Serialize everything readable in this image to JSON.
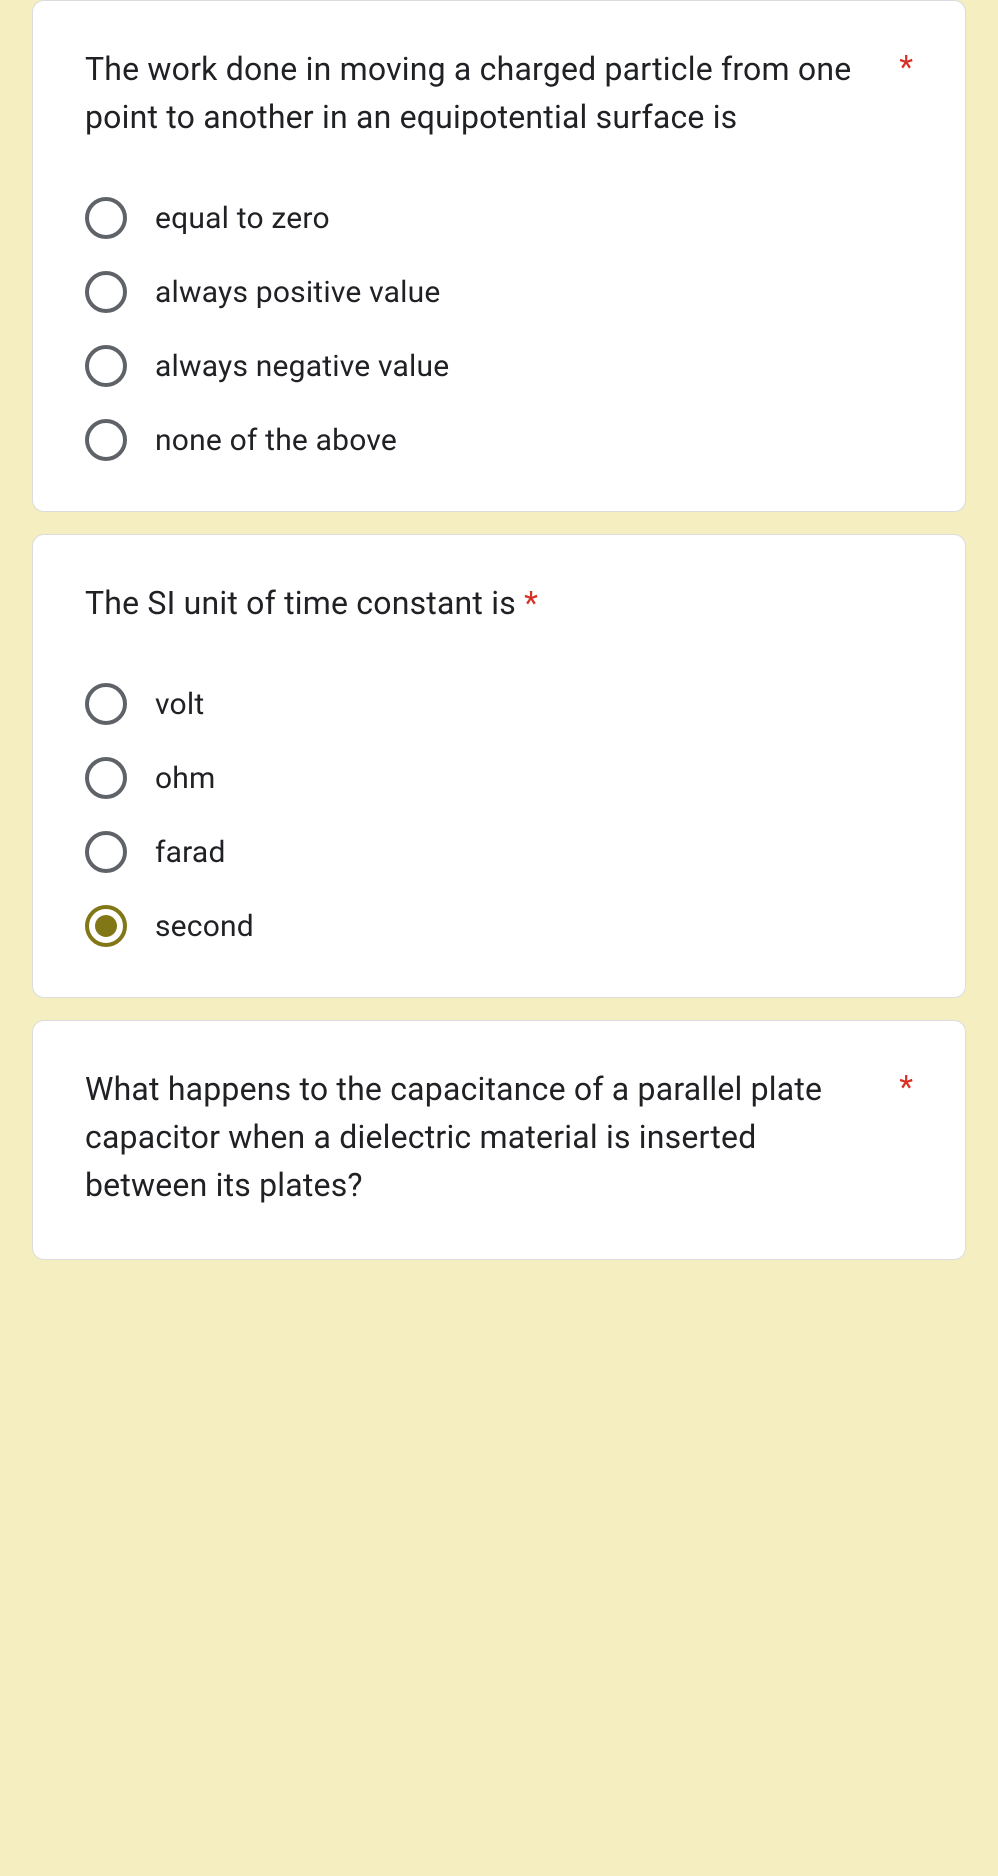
{
  "questions": [
    {
      "text": "The work done in moving a charged particle from one point to another in an equipotential surface is",
      "required": true,
      "asteriskSeparate": true,
      "options": [
        {
          "label": "equal to zero",
          "selected": false
        },
        {
          "label": "always positive value",
          "selected": false
        },
        {
          "label": "always negative value",
          "selected": false
        },
        {
          "label": "none of the above",
          "selected": false
        }
      ]
    },
    {
      "text": "The SI unit of time constant is",
      "required": true,
      "asteriskSeparate": false,
      "options": [
        {
          "label": "volt",
          "selected": false
        },
        {
          "label": "ohm",
          "selected": false
        },
        {
          "label": "farad",
          "selected": false
        },
        {
          "label": "second",
          "selected": true
        }
      ]
    },
    {
      "text": "What happens to the capacitance of a parallel plate capacitor when a dielectric material is inserted between its plates?",
      "required": true,
      "asteriskSeparate": true,
      "options": []
    }
  ],
  "requiredMark": "*"
}
